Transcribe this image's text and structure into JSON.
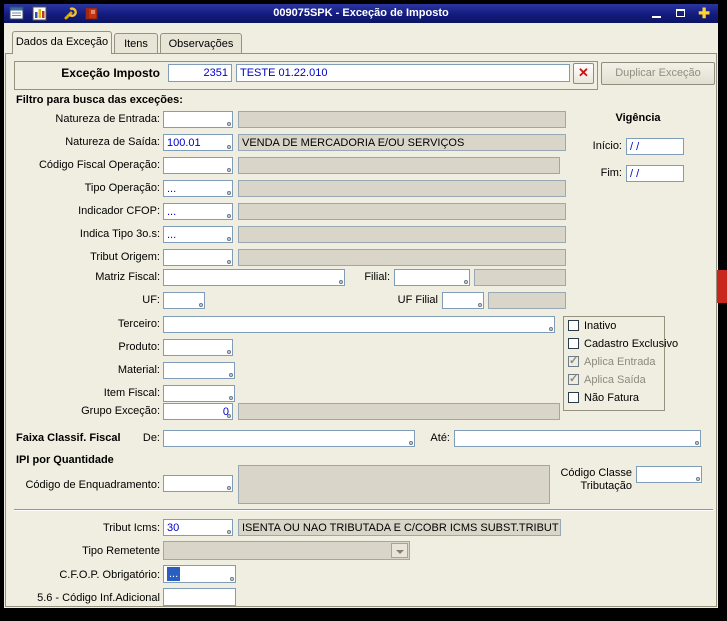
{
  "window": {
    "title": "009075SPK - Exceção de Imposto",
    "plus_glyph": "✚"
  },
  "tabs": {
    "dados": "Dados da Exceção",
    "itens": "Itens",
    "observacoes": "Observações"
  },
  "header": {
    "label": "Exceção Imposto",
    "code": "2351",
    "description": "TESTE 01.22.010",
    "delete_glyph": "✕",
    "duplicate_button": "Duplicar Exceção"
  },
  "filter": {
    "title": "Filtro para busca das exceções:",
    "rows": [
      {
        "label": "Natureza de Entrada:",
        "code": "",
        "desc": ""
      },
      {
        "label": "Natureza de Saída:",
        "code": "100.01",
        "desc": "VENDA DE MERCADORIA E/OU SERVIÇOS"
      },
      {
        "label": "Código Fiscal Operação:",
        "code": "",
        "desc": ""
      },
      {
        "label": "Tipo Operação:",
        "code": "...",
        "desc": ""
      },
      {
        "label": "Indicador CFOP:",
        "code": "...",
        "desc": ""
      },
      {
        "label": "Indica Tipo 3o.s:",
        "code": "...",
        "desc": ""
      },
      {
        "label": "Tribut Origem:",
        "code": "",
        "desc": ""
      }
    ],
    "matriz": {
      "label": "Matriz Fiscal:",
      "value": "",
      "filial_label": "Filial:",
      "filial_value": "",
      "rest": ""
    },
    "uf": {
      "label": "UF:",
      "value": "",
      "uf_filial_label": "UF Filial",
      "uf_filial_value": "",
      "rest": ""
    },
    "terceiro": {
      "label": "Terceiro:",
      "value": ""
    },
    "produto": {
      "label": "Produto:",
      "value": ""
    },
    "material": {
      "label": "Material:",
      "value": ""
    },
    "item_fiscal": {
      "label": "Item Fiscal:",
      "value": ""
    },
    "grupo": {
      "label": "Grupo Exceção:",
      "value": "0",
      "desc": ""
    }
  },
  "vigencia": {
    "title": "Vigência",
    "inicio_label": "Início:",
    "inicio_value": "/  /",
    "fim_label": "Fim:",
    "fim_value": "/  /"
  },
  "flags": [
    {
      "label": "Inativo",
      "check": ""
    },
    {
      "label": "Cadastro Exclusivo",
      "check": ""
    },
    {
      "label": "Aplica Entrada",
      "check": "✓"
    },
    {
      "label": "Aplica Saída",
      "check": "✓"
    },
    {
      "label": "Não Fatura",
      "check": ""
    }
  ],
  "faixa": {
    "title": "Faixa Classif. Fiscal",
    "de_label": "De:",
    "de_value": "",
    "ate_label": "Até:",
    "ate_value": ""
  },
  "ipi": {
    "title": "IPI por Quantidade",
    "enquadramento_label": "Código de Enquadramento:",
    "enquadramento_code": "",
    "enquadramento_desc": "",
    "classe_label_line1": "Código Classe",
    "classe_label_line2": "Tributação",
    "classe_value": ""
  },
  "icms": {
    "tribut_label": "Tribut Icms:",
    "tribut_code": "30",
    "tribut_desc": "ISENTA OU NAO TRIBUTADA E C/COBR ICMS SUBST.TRIBUT",
    "remetente_label": "Tipo Remetente",
    "remetente_value": "",
    "cfop_label": "C.F.O.P. Obrigatório:",
    "cfop_value": "...",
    "inf_adicional_label": "5.6 - Código Inf.Adicional",
    "inf_adicional_value": ""
  }
}
